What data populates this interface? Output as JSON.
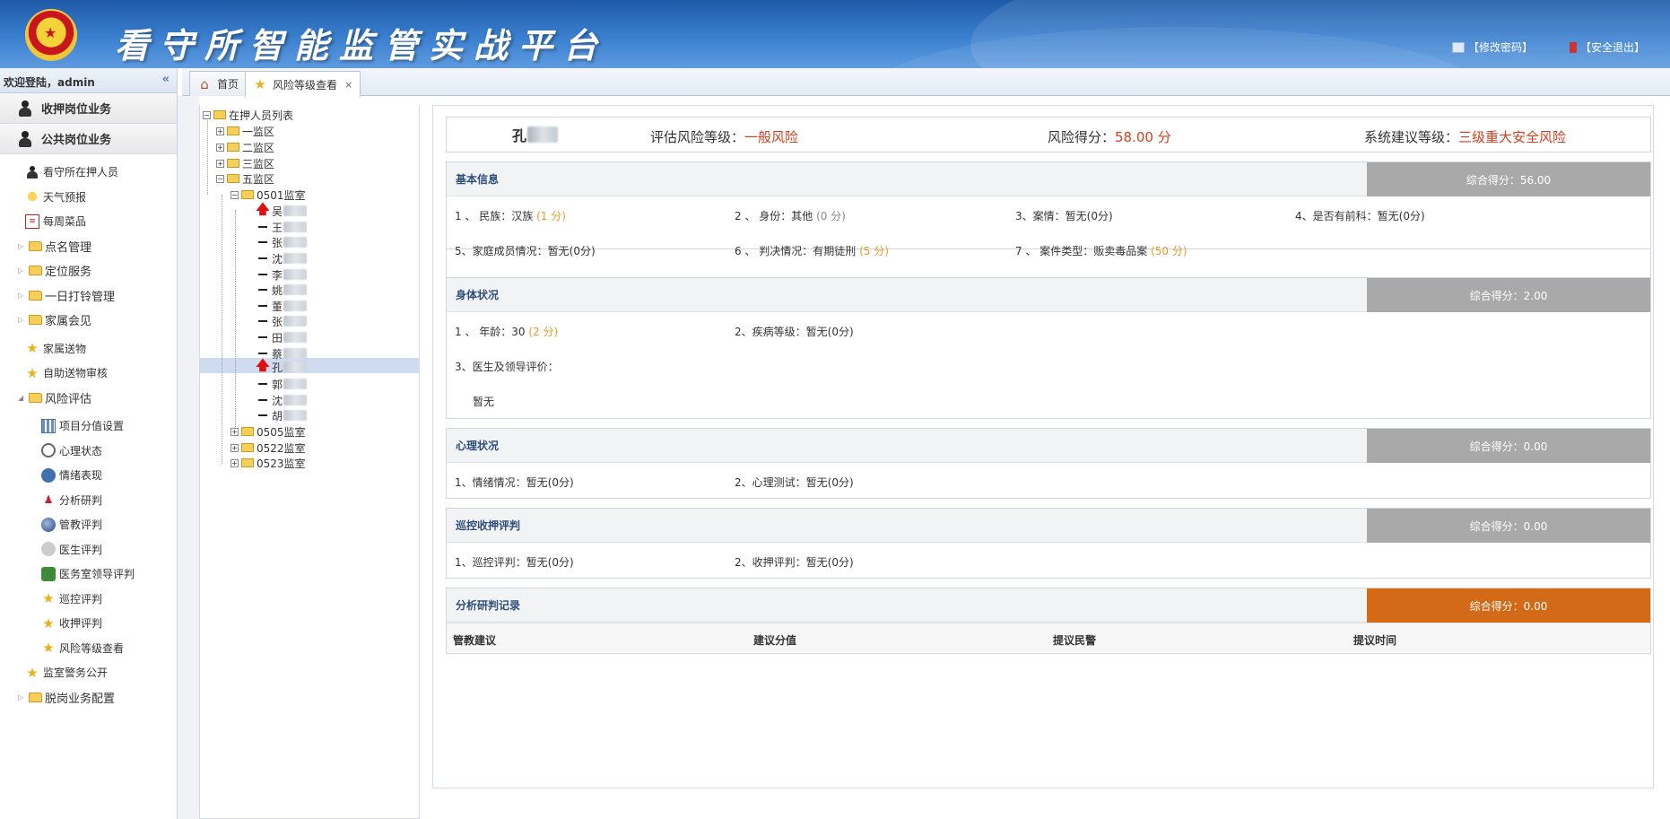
{
  "header": {
    "app_title": "看守所智能监管实战平台",
    "change_password": "【修改密码】",
    "logout": "【安全退出】"
  },
  "sidebar": {
    "welcome": "欢迎登陆，admin",
    "accordions": [
      "收押岗位业务",
      "公共岗位业务"
    ],
    "items": [
      {
        "label": "看守所在押人员",
        "icon": "person-icon"
      },
      {
        "label": "天气预报",
        "icon": "sun-icon"
      },
      {
        "label": "每周菜品",
        "icon": "menu-icon"
      },
      {
        "label": "点名管理",
        "icon": "folder-icon"
      },
      {
        "label": "定位服务",
        "icon": "folder-icon"
      },
      {
        "label": "一日打铃管理",
        "icon": "folder-icon"
      },
      {
        "label": "家属会见",
        "icon": "folder-icon"
      },
      {
        "label": "家属送物",
        "icon": "star-icon"
      },
      {
        "label": "自助送物审核",
        "icon": "star-icon"
      },
      {
        "label": "风险评估",
        "icon": "folder-open-icon"
      },
      {
        "label": "项目分值设置",
        "icon": "grid-icon"
      },
      {
        "label": "心理状态",
        "icon": "clock-icon"
      },
      {
        "label": "情绪表现",
        "icon": "face-icon"
      },
      {
        "label": "分析研判",
        "icon": "group-icon"
      },
      {
        "label": "管教评判",
        "icon": "globe-icon"
      },
      {
        "label": "医生评判",
        "icon": "doctor-icon"
      },
      {
        "label": "医务室领导评判",
        "icon": "leader-icon"
      },
      {
        "label": "巡控评判",
        "icon": "star-icon"
      },
      {
        "label": "收押评判",
        "icon": "star-icon"
      },
      {
        "label": "风险等级查看",
        "icon": "star-icon"
      },
      {
        "label": "监室警务公开",
        "icon": "star-icon"
      },
      {
        "label": "脱岗业务配置",
        "icon": "folder-icon"
      }
    ]
  },
  "tabs": [
    {
      "label": "首页",
      "icon": "home-icon"
    },
    {
      "label": "风险等级查看",
      "icon": "star-icon",
      "close": "×"
    }
  ],
  "tree": {
    "root": "在押人员列表",
    "areas": [
      "一监区",
      "二监区",
      "三监区",
      "五监区"
    ],
    "room_open": "0501监室",
    "people": [
      "吴",
      "王",
      "张",
      "沈",
      "李",
      "姚",
      "董",
      "张",
      "田",
      "蔡",
      "孔",
      "郭",
      "沈",
      "胡"
    ],
    "rooms_closed": [
      "0505监室",
      "0522监室",
      "0523监室"
    ]
  },
  "summary": {
    "name": "孔",
    "risk_level_label": "评估风险等级：",
    "risk_level_value": "一般风险",
    "risk_score_label": "风险得分：",
    "risk_score_value": "58.00 分",
    "suggest_label": "系统建议等级：",
    "suggest_value": "三级重大安全风险"
  },
  "sections": {
    "basic": {
      "title": "基本信息",
      "score": "综合得分：56.00",
      "f1": "1 、 民族：汉族",
      "f1s": "(1 分)",
      "f2": "2 、 身份：其他",
      "f2s": "(0 分)",
      "f3": "3、案情：暂无(0分)",
      "f4": "4、是否有前科：暂无(0分)",
      "f5": "5、家庭成员情况：暂无(0分)",
      "f6": "6 、 判决情况：有期徒刑",
      "f6s": "(5 分)",
      "f7": "7 、 案件类型：贩卖毒品案",
      "f7s": "(50 分)"
    },
    "body": {
      "title": "身体状况",
      "score": "综合得分：2.00",
      "f1": "1 、 年龄：30",
      "f1s": "(2 分)",
      "f2": "2、疾病等级：暂无(0分)",
      "f3": "3、医生及领导评价：",
      "f3v": "暂无"
    },
    "mind": {
      "title": "心理状况",
      "score": "综合得分：0.00",
      "f1": "1、情绪情况：暂无(0分)",
      "f2": "2、心理测试：暂无(0分)"
    },
    "patrol": {
      "title": "巡控收押评判",
      "score": "综合得分：0.00",
      "f1": "1、巡控评判：暂无(0分)",
      "f2": "2、收押评判：暂无(0分)"
    },
    "records": {
      "title": "分析研判记录",
      "score": "综合得分：0.00",
      "columns": [
        "管教建议",
        "建议分值",
        "提议民警",
        "提议时间"
      ]
    }
  }
}
